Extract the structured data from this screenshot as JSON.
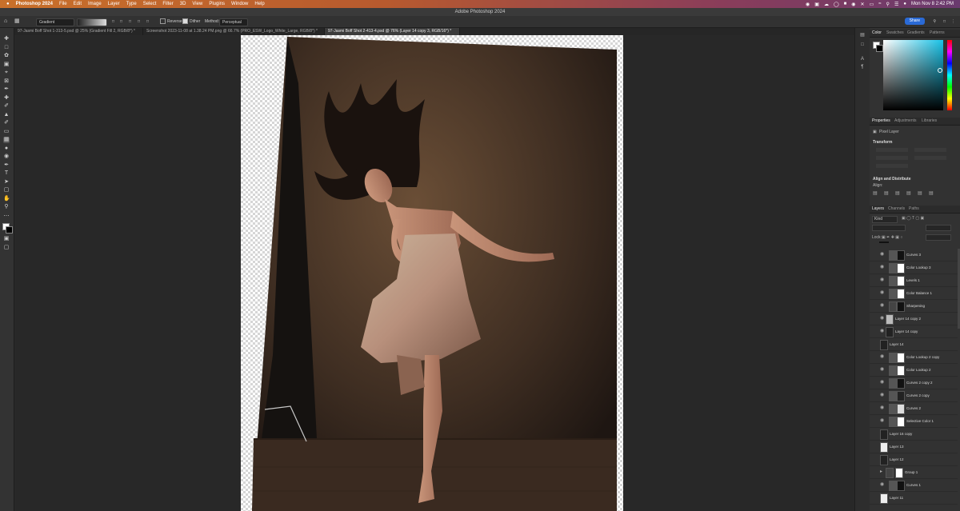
{
  "menubar": {
    "apple": "",
    "app": "Photoshop 2024",
    "items": [
      "File",
      "Edit",
      "Image",
      "Layer",
      "Type",
      "Select",
      "Filter",
      "3D",
      "View",
      "Plugins",
      "Window",
      "Help"
    ],
    "datetime": "Mon Nov 8  2:42 PM",
    "icons": [
      "record-icon",
      "display-icon",
      "cloud-icon",
      "circle-icon",
      "app-icon",
      "lock-icon",
      "bluetooth-icon",
      "battery-icon",
      "wifi-icon",
      "search-icon",
      "control-center-icon",
      "siri-icon"
    ]
  },
  "window_title": "Adobe Photoshop 2024",
  "options": {
    "preset": "Gradient",
    "reverse_label": "Reverse",
    "dither_label": "Dither",
    "method_label": "Method:",
    "method_value": "Perceptual",
    "share_label": "Share"
  },
  "tabs": [
    {
      "label": "97-Jasmi Boff Shot 1-313-5.psd @ 25% (Gradient Fill 2, RGB/8*) *",
      "active": false
    },
    {
      "label": "Screenshot 2023-11-08 at 1.38.24 PM.png @ 66.7% (PRO_ESW_Logo_White_Large, RGB/8*) *",
      "active": false
    },
    {
      "label": "97-Jasmi Boff Shot 2-413-4.psd @ 76% (Layer 14 copy 3, RGB/16*) *",
      "active": true
    }
  ],
  "panels": {
    "color_tabs": [
      "Color",
      "Swatches",
      "Gradients",
      "Patterns"
    ],
    "properties_tabs": [
      "Properties",
      "Adjustments",
      "Libraries"
    ],
    "pixel_layer": "Pixel Layer",
    "transform": "Transform",
    "align": "Align and Distribute",
    "align_sub": "Align:",
    "layers_tabs": [
      "Layers",
      "Channels",
      "Paths"
    ],
    "kind_label": "Kind",
    "lock_label": "Lock:"
  },
  "layers": [
    {
      "name": "Curves 3"
    },
    {
      "name": "Color Lookup 3"
    },
    {
      "name": "Levels 1"
    },
    {
      "name": "Color Balance 1"
    },
    {
      "name": "Sharpening"
    },
    {
      "name": "Layer 14 copy 2"
    },
    {
      "name": "Layer 14 copy"
    },
    {
      "name": "Layer 14"
    },
    {
      "name": "Color Lookup 2 copy"
    },
    {
      "name": "Color Lookup 2"
    },
    {
      "name": "Curves 2 copy 2"
    },
    {
      "name": "Curves 2 copy"
    },
    {
      "name": "Curves 2"
    },
    {
      "name": "Selective Color 1"
    },
    {
      "name": "Layer 16 copy"
    },
    {
      "name": "Layer 13"
    },
    {
      "name": "Layer 12"
    },
    {
      "name": "Group 1"
    },
    {
      "name": "Curves 1"
    },
    {
      "name": "Layer 11"
    }
  ],
  "colors": {
    "accent": "#2a6ad6",
    "panel": "#323232",
    "canvas": "#282828"
  }
}
